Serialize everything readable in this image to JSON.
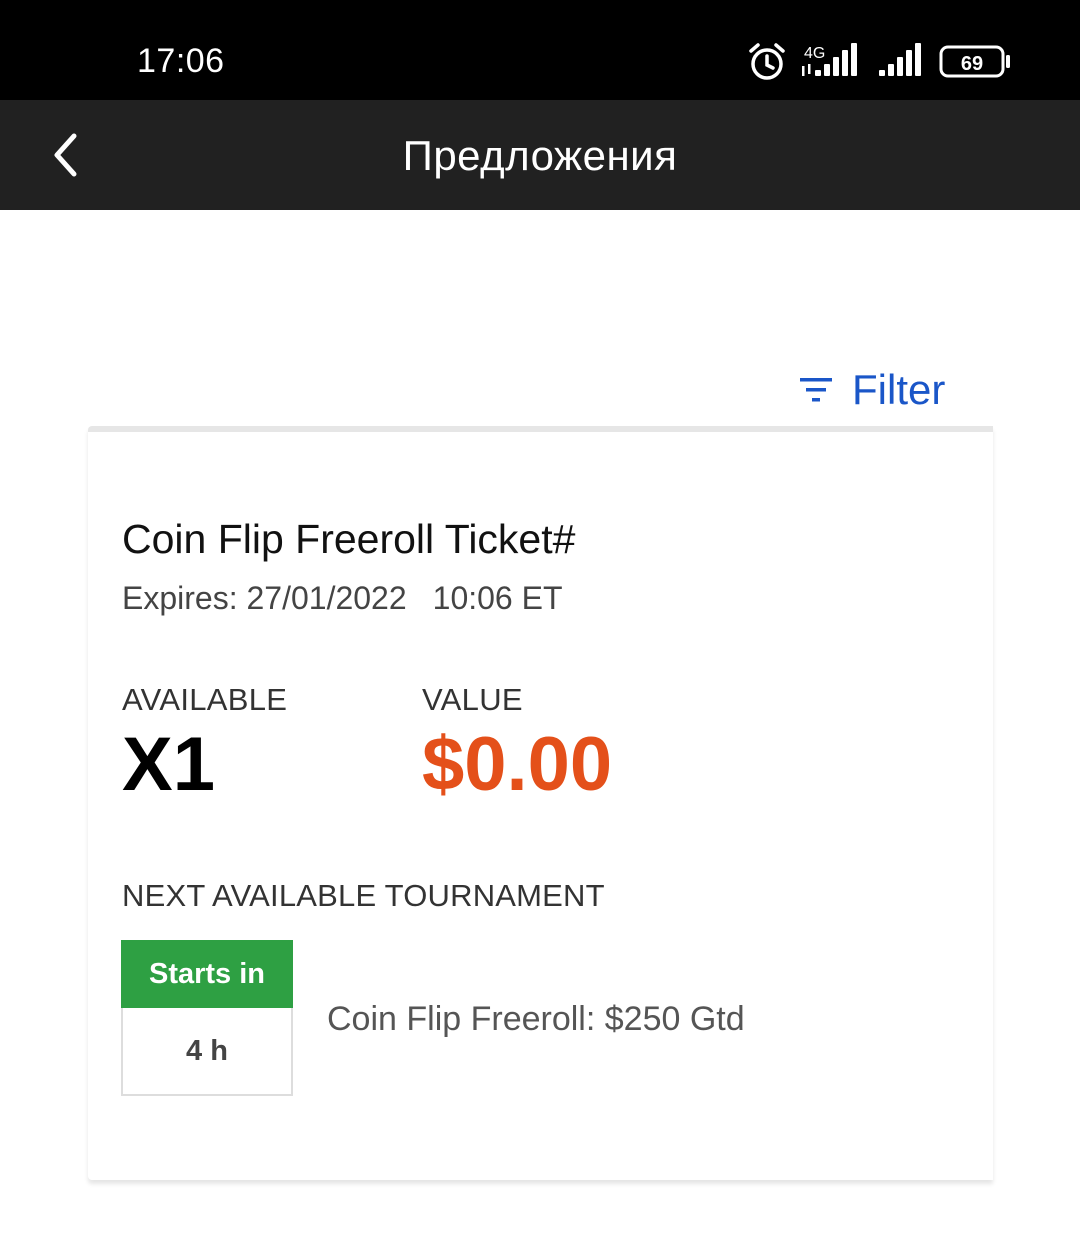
{
  "status_bar": {
    "time": "17:06",
    "network_type": "4G",
    "battery_level": "69",
    "icons": [
      "alarm-icon",
      "signal-icon",
      "signal-icon",
      "battery-icon"
    ]
  },
  "app_bar": {
    "title": "Предложения",
    "back_icon": "chevron-left-icon"
  },
  "filter": {
    "label": "Filter",
    "icon": "filter-icon",
    "color": "#1a56c8"
  },
  "offer": {
    "title": "Coin Flip Freeroll Ticket#",
    "expires_label": "Expires: 27/01/2022",
    "expires_time": "10:06 ET",
    "available_label": "AVAILABLE",
    "available_value": "X1",
    "value_label": "VALUE",
    "value_amount": "$0.00",
    "value_color": "#e4501a",
    "next_tournament_label": "NEXT AVAILABLE TOURNAMENT",
    "starts_in_label": "Starts in",
    "starts_in_value": "4 h",
    "starts_in_color": "#2ea043",
    "tournament_name": "Coin Flip Freeroll: $250 Gtd"
  }
}
